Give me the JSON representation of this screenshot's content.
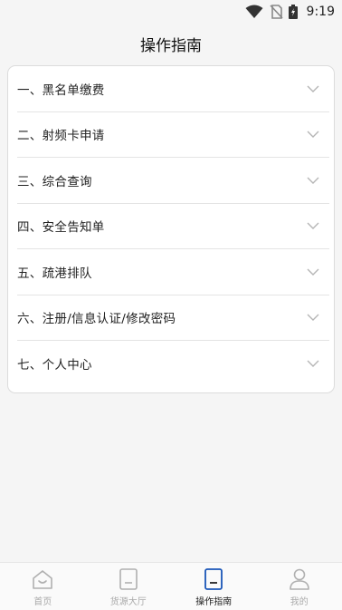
{
  "status_bar": {
    "time": "9:19",
    "icons": [
      "wifi-icon",
      "no-sim-icon",
      "battery-charging-icon"
    ]
  },
  "header": {
    "title": "操作指南"
  },
  "guide_list": [
    {
      "label": "一、黑名单缴费"
    },
    {
      "label": "二、射频卡申请"
    },
    {
      "label": "三、综合查询"
    },
    {
      "label": "四、安全告知单"
    },
    {
      "label": "五、疏港排队"
    },
    {
      "label": "六、注册/信息认证/修改密码"
    },
    {
      "label": "七、个人中心"
    }
  ],
  "tabbar": {
    "tabs": [
      {
        "label": "首页",
        "icon": "home-icon",
        "active": false
      },
      {
        "label": "货源大厅",
        "icon": "cargo-hall-icon",
        "active": false
      },
      {
        "label": "操作指南",
        "icon": "guide-icon",
        "active": true
      },
      {
        "label": "我的",
        "icon": "profile-icon",
        "active": false
      }
    ]
  },
  "colors": {
    "accent": "#1a56b8",
    "inactive": "#aaaaaa",
    "divider": "#e4e4e4"
  }
}
